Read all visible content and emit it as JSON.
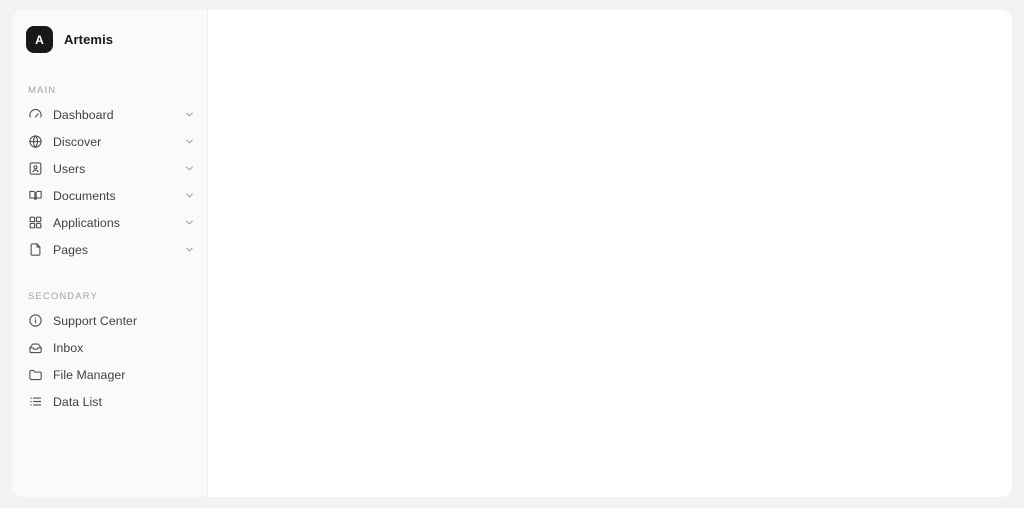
{
  "brand": {
    "initial": "A",
    "name": "Artemis"
  },
  "sidebar": {
    "sections": [
      {
        "label": "MAIN",
        "items": [
          {
            "label": "Dashboard",
            "icon": "gauge-icon",
            "chevron": "chevron-down-icon"
          },
          {
            "label": "Discover",
            "icon": "globe-icon",
            "chevron": "chevron-down-icon"
          },
          {
            "label": "Users",
            "icon": "contact-card-icon",
            "chevron": "chevron-down-icon"
          },
          {
            "label": "Documents",
            "icon": "book-open-icon",
            "chevron": "chevron-down-icon"
          },
          {
            "label": "Applications",
            "icon": "grid-icon",
            "chevron": "chevron-down-icon"
          },
          {
            "label": "Pages",
            "icon": "file-icon",
            "chevron": "chevron-down-icon"
          }
        ]
      },
      {
        "label": "SECONDARY",
        "items": [
          {
            "label": "Support Center",
            "icon": "info-circle-icon"
          },
          {
            "label": "Inbox",
            "icon": "inbox-icon"
          },
          {
            "label": "File Manager",
            "icon": "folder-icon"
          },
          {
            "label": "Data List",
            "icon": "list-icon"
          }
        ]
      }
    ]
  },
  "main": {
    "content": ""
  },
  "colors": {
    "page_background": "#f1f3f5",
    "card_background": "#ffffff",
    "sidebar_background": "#fafafa",
    "divider": "#ececee",
    "brand_badge": "#18181b",
    "label_text": "#3f3f46",
    "muted_text": "#a1a1aa"
  }
}
